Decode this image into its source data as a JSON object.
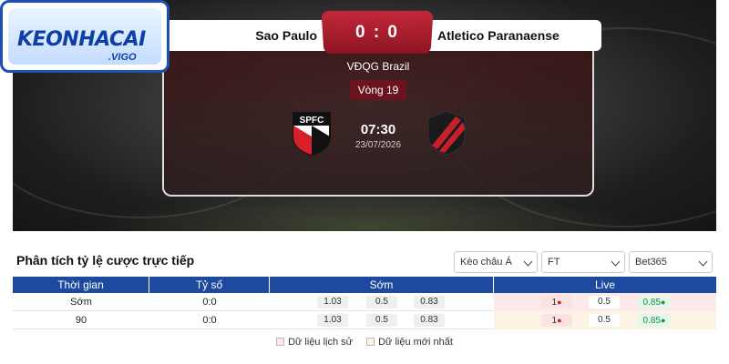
{
  "match": {
    "home_team": "Sao Paulo",
    "away_team": "Atletico Paranaense",
    "score": "0 : 0",
    "league": "VĐQG Brazil",
    "round": "Vòng 19",
    "time": "07:30",
    "date": "23/07/2026",
    "home_crest_text": "SPFC"
  },
  "logo": {
    "main": "KEONHACAI",
    "sub": ".VIGO"
  },
  "odds_panel": {
    "title": "Phân tích tỷ lệ cược trực tiếp",
    "filters": [
      "Kèo châu Á",
      "FT",
      "Bet365"
    ],
    "headers": [
      "Thời gian",
      "Tỷ số",
      "Sớm",
      "Live"
    ],
    "rows": [
      {
        "time": "Sớm",
        "score": "0:0",
        "early": [
          "1.03",
          "0.5",
          "0.83"
        ],
        "live": [
          "1",
          "0.5",
          "0.85"
        ]
      },
      {
        "time": "90",
        "score": "0:0",
        "early": [
          "1.03",
          "0.5",
          "0.83"
        ],
        "live": [
          "1",
          "0.5",
          "0.85"
        ]
      }
    ],
    "legend": [
      "Dữ liệu lịch sử",
      "Dữ liệu mới nhất"
    ]
  },
  "colors": {
    "header_blue": "#1d4a9e",
    "score_red": "#c2283a",
    "round_badge": "#6b1420",
    "live_up": "#fbe3e3",
    "live_down": "#e3f7ea"
  },
  "icons": [
    "home-team-crest-icon",
    "away-team-crest-icon",
    "dropdown-caret-icon",
    "odds-up-arrow-icon",
    "odds-down-arrow-icon"
  ]
}
